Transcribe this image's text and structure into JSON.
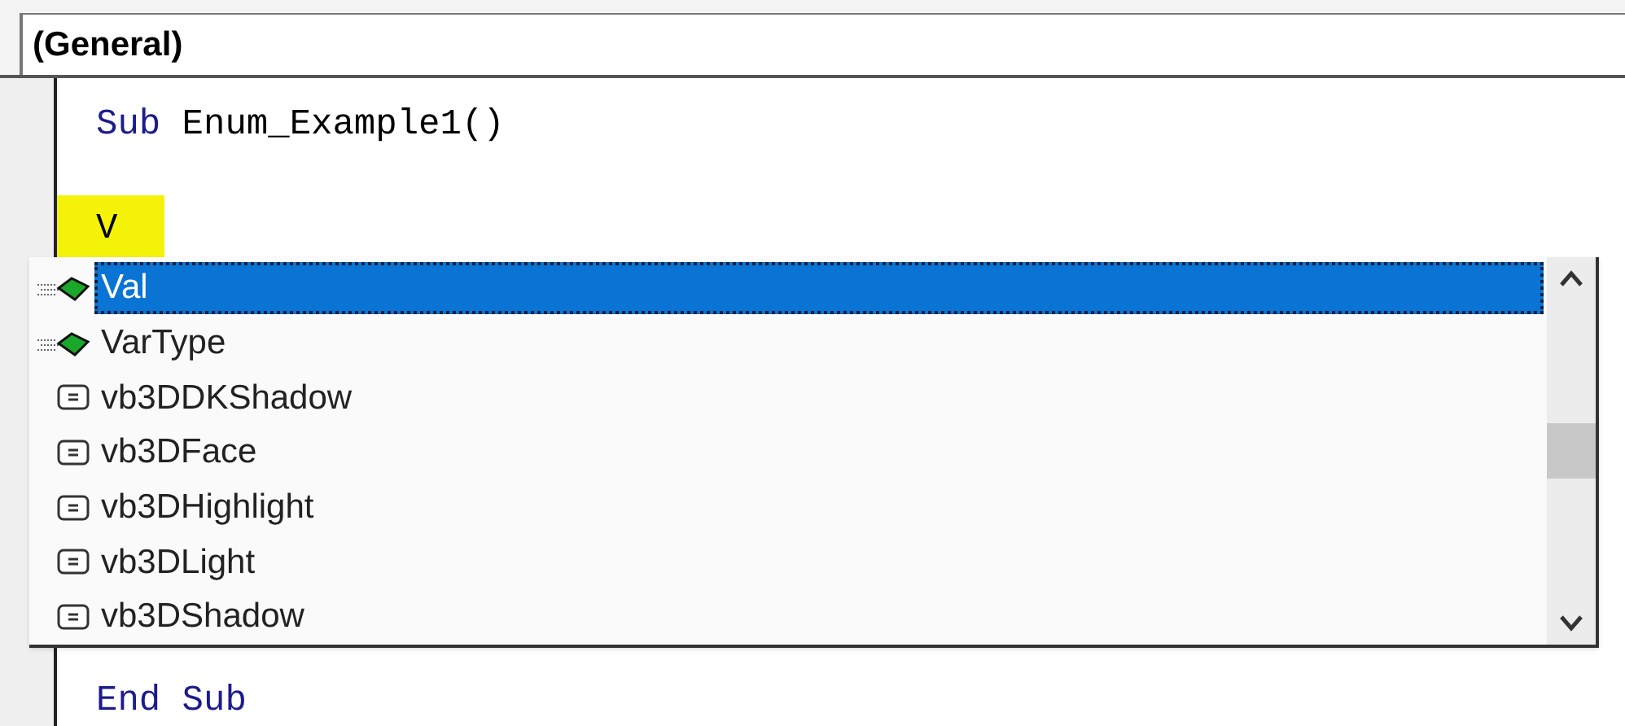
{
  "object_box": {
    "value": "(General)"
  },
  "code_lines": [
    {
      "keyword": "Sub",
      "text": " Enum_Example1()"
    }
  ],
  "typed": {
    "text": "V"
  },
  "completion_list": [
    {
      "label": "Val",
      "kind": "function",
      "selected": true
    },
    {
      "label": "VarType",
      "kind": "function",
      "selected": false
    },
    {
      "label": "vb3DDKShadow",
      "kind": "constant",
      "selected": false
    },
    {
      "label": "vb3DFace",
      "kind": "constant",
      "selected": false
    },
    {
      "label": "vb3DHighlight",
      "kind": "constant",
      "selected": false
    },
    {
      "label": "vb3DLight",
      "kind": "constant",
      "selected": false
    },
    {
      "label": "vb3DShadow",
      "kind": "constant",
      "selected": false
    }
  ],
  "end_line": {
    "keyword": "End Sub"
  }
}
